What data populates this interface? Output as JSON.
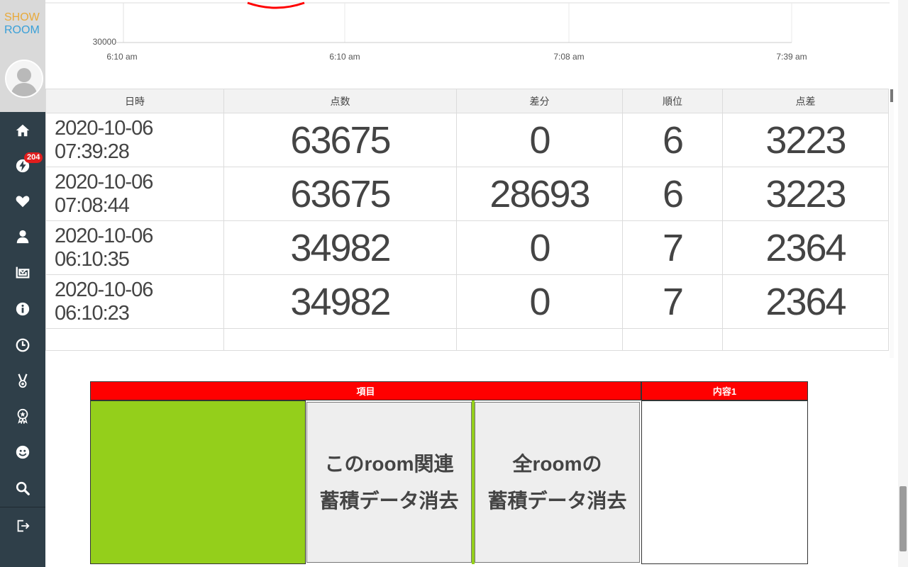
{
  "sidebar": {
    "logo_line1": "SHOW",
    "logo_line2": "ROOM",
    "badge_count": "204",
    "items": [
      {
        "icon": "home-icon"
      },
      {
        "icon": "lightning-icon"
      },
      {
        "icon": "heart-icon"
      },
      {
        "icon": "person-icon"
      },
      {
        "icon": "mail-icon"
      },
      {
        "icon": "info-icon"
      },
      {
        "icon": "clock-icon"
      },
      {
        "icon": "medal-icon"
      },
      {
        "icon": "award-icon"
      },
      {
        "icon": "smiley-icon"
      },
      {
        "icon": "search-icon"
      },
      {
        "icon": "logout-icon"
      }
    ]
  },
  "chart": {
    "y_tick": "30000",
    "x_ticks": [
      "6:10 am",
      "6:10 am",
      "7:08 am",
      "7:39 am"
    ]
  },
  "table": {
    "headers": [
      "日時",
      "点数",
      "差分",
      "順位",
      "点差"
    ],
    "rows": [
      [
        "2020-10-06 07:39:28",
        "63675",
        "0",
        "6",
        "3223"
      ],
      [
        "2020-10-06 07:08:44",
        "63675",
        "28693",
        "6",
        "3223"
      ],
      [
        "2020-10-06 06:10:35",
        "34982",
        "0",
        "7",
        "2364"
      ],
      [
        "2020-10-06 06:10:23",
        "34982",
        "0",
        "7",
        "2364"
      ]
    ]
  },
  "controls": {
    "header_item": "項目",
    "header_content": "内容1",
    "btn_room_line1": "このroom関連",
    "btn_room_line2": "蓄積データ消去",
    "btn_all_line1": "全roomの",
    "btn_all_line2": "蓄積データ消去"
  },
  "colors": {
    "sidebar_bg": "#2f3f49",
    "header_red": "#ff0000",
    "accent_green": "#94cf1b",
    "badge_red": "#e21d1d"
  }
}
